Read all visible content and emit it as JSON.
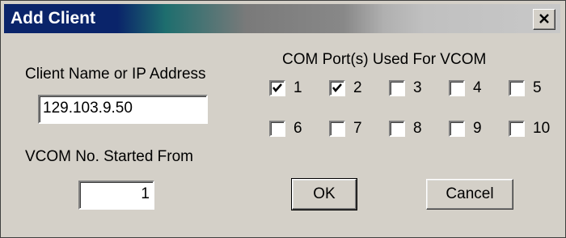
{
  "window": {
    "title": "Add Client",
    "close_glyph": "×"
  },
  "client": {
    "label": "Client Name or IP Address",
    "value": "129.103.9.50"
  },
  "vcom": {
    "label": "VCOM No. Started From",
    "value": "1"
  },
  "com_ports": {
    "label": "COM Port(s) Used For VCOM",
    "items": [
      {
        "label": "1",
        "checked": true
      },
      {
        "label": "2",
        "checked": true
      },
      {
        "label": "3",
        "checked": false
      },
      {
        "label": "4",
        "checked": false
      },
      {
        "label": "5",
        "checked": false
      },
      {
        "label": "6",
        "checked": false
      },
      {
        "label": "7",
        "checked": false
      },
      {
        "label": "8",
        "checked": false
      },
      {
        "label": "9",
        "checked": false
      },
      {
        "label": "10",
        "checked": false
      }
    ]
  },
  "buttons": {
    "ok": "OK",
    "cancel": "Cancel"
  }
}
